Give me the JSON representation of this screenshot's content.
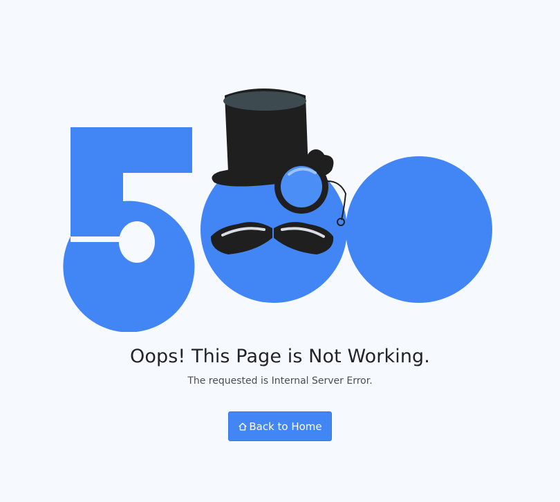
{
  "error": {
    "code": "500",
    "title": "Oops! This Page is Not Working.",
    "message": "The requested is Internal Server Error."
  },
  "actions": {
    "home_label": "Back to Home",
    "home_icon": "home-icon"
  },
  "colors": {
    "background": "#f6f9fe",
    "accent": "#4285f4",
    "hat": "#1f1f1f",
    "text": "#222428"
  },
  "illustration": {
    "icons": [
      "top-hat-icon",
      "monocle-icon",
      "mustache-icon"
    ]
  }
}
